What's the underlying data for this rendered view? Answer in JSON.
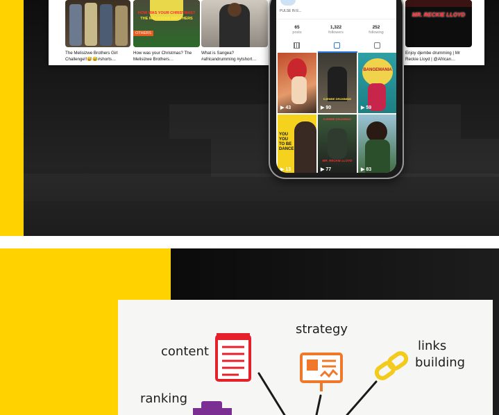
{
  "youtube": {
    "videos": [
      {
        "title": "The Melisizwe Brothers Girl Challenge!!😅😅#shorts…",
        "thumb_text": ""
      },
      {
        "title": "How was your Christmas? The Melisizwe Brothers…",
        "thumb_text": "HOW WAS YOUR CHRISTMAS?",
        "thumb_subtext": "THE MELISIZWE BROTHERS",
        "thumb_tag": "OTHERS"
      },
      {
        "title": "What is Sangea? #africandrumming #ytshort…",
        "thumb_text": ""
      },
      {
        "title": "Enjoy djembe drumming | Mr Reckie Lloyd | @African…",
        "thumb_text": "MR. RECKIE LLOYD"
      }
    ]
  },
  "instagram": {
    "profile_name": "PULSE IN E...",
    "stats": [
      {
        "value": "65",
        "label": "posts"
      },
      {
        "value": "1,322",
        "label": "followers"
      },
      {
        "value": "252",
        "label": "following"
      }
    ],
    "grid": [
      {
        "count": "43"
      },
      {
        "count": "90"
      },
      {
        "count": "59"
      },
      {
        "count": "13"
      },
      {
        "count": "77"
      },
      {
        "count": "83"
      }
    ],
    "grid_texts": {
      "cell3": "BANGEMANIA",
      "cell4": "YOU YOU TO BE DANCE",
      "cell5": "MR. RECKIE LLOYD",
      "cell5_top": "DJEMBE DRUMMING"
    }
  },
  "whiteboard": {
    "words": [
      "content",
      "strategy",
      "links",
      "building",
      "ranking"
    ]
  },
  "colors": {
    "accent": "#ffd200",
    "red": "#e5202a",
    "orange": "#f0782a",
    "yellow_icon": "#f2cb1d",
    "purple": "#7b2f92"
  }
}
